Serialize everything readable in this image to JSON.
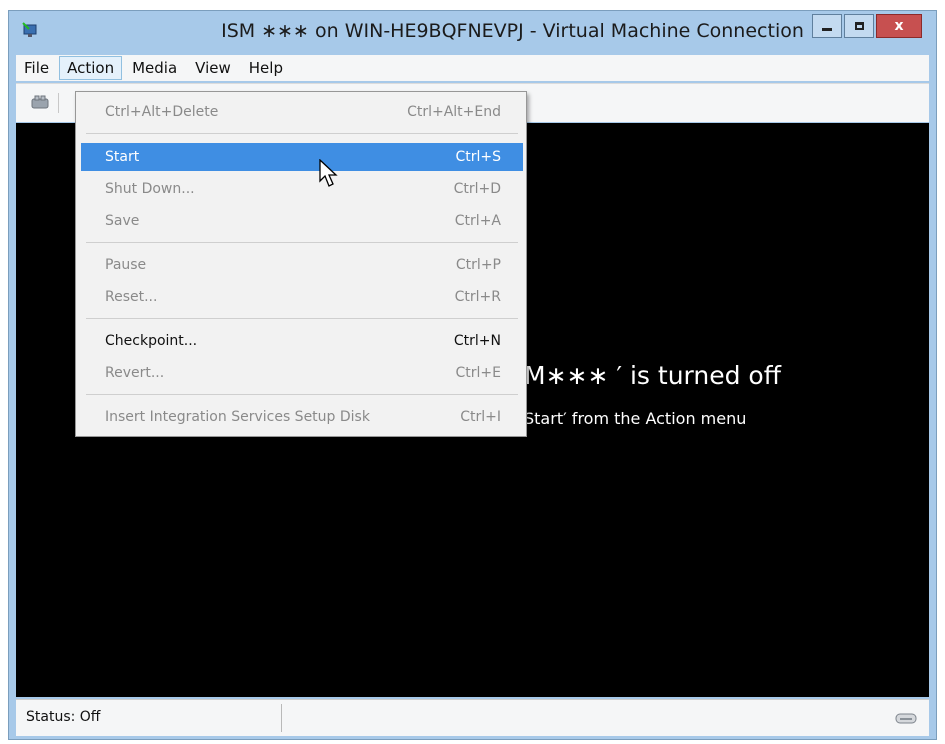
{
  "window": {
    "title": "ISM ∗∗∗ on WIN-HE9BQFNEVPJ - Virtual Machine Connection",
    "icon": "vm-connection-icon",
    "buttons": {
      "minimize": "minimize",
      "maximize": "maximize",
      "close": "x"
    }
  },
  "menubar": {
    "items": [
      {
        "label": "File"
      },
      {
        "label": "Action"
      },
      {
        "label": "Media"
      },
      {
        "label": "View"
      },
      {
        "label": "Help"
      }
    ]
  },
  "action_menu": {
    "items": [
      {
        "label": "Ctrl+Alt+Delete",
        "shortcut": "Ctrl+Alt+End",
        "enabled": false
      },
      {
        "label": "Start",
        "shortcut": "Ctrl+S",
        "enabled": true,
        "highlighted": true
      },
      {
        "label": "Shut Down...",
        "shortcut": "Ctrl+D",
        "enabled": false
      },
      {
        "label": "Save",
        "shortcut": "Ctrl+A",
        "enabled": false
      },
      {
        "label": "Pause",
        "shortcut": "Ctrl+P",
        "enabled": false
      },
      {
        "label": "Reset...",
        "shortcut": "Ctrl+R",
        "enabled": false
      },
      {
        "label": "Checkpoint...",
        "shortcut": "Ctrl+N",
        "enabled": true
      },
      {
        "label": "Revert...",
        "shortcut": "Ctrl+E",
        "enabled": false
      },
      {
        "label": "Insert Integration Services Setup Disk",
        "shortcut": "Ctrl+I",
        "enabled": false
      }
    ]
  },
  "screen": {
    "message_main": "M∗∗∗ ′ is turned off",
    "message_sub": "Start′ from the Action menu"
  },
  "status": {
    "text": "Status: Off"
  },
  "colors": {
    "titlebar": "#a7c9e9",
    "highlight": "#3f8ee3",
    "close": "#c75050"
  }
}
